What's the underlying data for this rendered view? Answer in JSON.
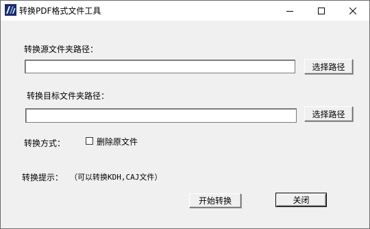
{
  "window": {
    "title": "转换PDF格式文件工具",
    "icon": "app-logo-icon",
    "controls": {
      "minimize": "minimize-icon",
      "maximize": "maximize-icon",
      "close": "close-icon"
    }
  },
  "form": {
    "source_label": "转换源文件夹路径：",
    "source_value": "",
    "source_browse": "选择路径",
    "target_label": "转换目标文件夹路径：",
    "target_value": "",
    "target_browse": "选择路径",
    "mode_label": "转换方式：",
    "delete_checkbox": {
      "label": "删除原文件",
      "checked": false
    },
    "hint_label": "转换提示：",
    "hint_text": "（可以转换KDH,CAJ文件）",
    "start_button": "开始转换",
    "close_button": "关闭"
  }
}
